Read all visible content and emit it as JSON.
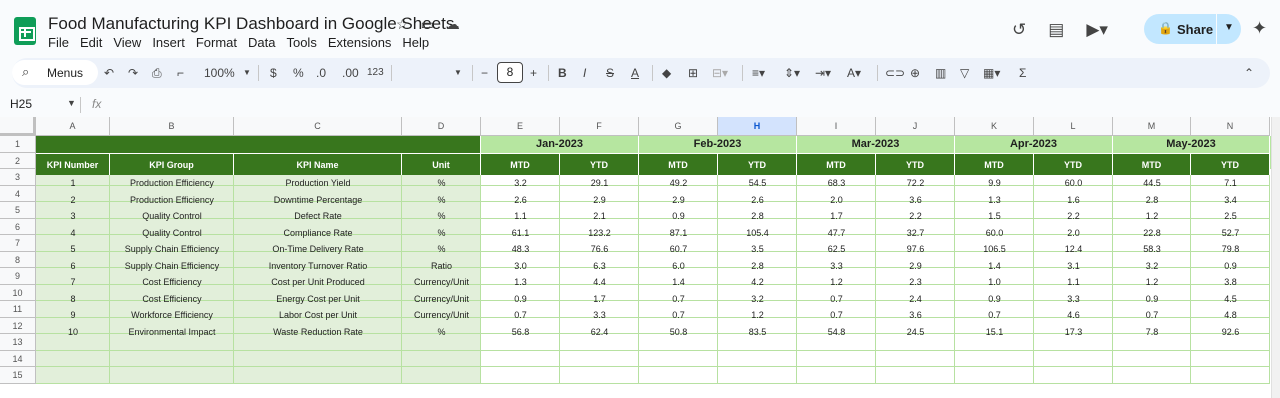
{
  "app": {
    "title": "Food Manufacturing KPI Dashboard in Google Sheets",
    "menu": [
      "File",
      "Edit",
      "View",
      "Insert",
      "Format",
      "Data",
      "Tools",
      "Extensions",
      "Help"
    ],
    "share_label": "Share"
  },
  "toolbar": {
    "menus_label": "Menus",
    "zoom": "100%",
    "currency": "$",
    "percent": "%",
    "dec_decrease": ".0",
    "dec_increase": ".00",
    "number_format": "123",
    "font_size": "8"
  },
  "formula_bar": {
    "cell_ref": "H25",
    "fx": "fx"
  },
  "colors": {
    "header_dark": "#38761d",
    "header_light": "#b6e6a0",
    "info_bg": "#e2efda",
    "grid_line": "#b7e1a1",
    "selected_col": "#d3e3fd"
  },
  "columns": [
    "A",
    "B",
    "C",
    "D",
    "E",
    "F",
    "G",
    "H",
    "I",
    "J",
    "K",
    "L",
    "M",
    "N"
  ],
  "selected_column": "H",
  "rows": [
    "1",
    "2",
    "3",
    "4",
    "5",
    "6",
    "7",
    "8",
    "9",
    "10",
    "11",
    "12",
    "13",
    "14",
    "15"
  ],
  "months": [
    "Jan-2023",
    "Feb-2023",
    "Mar-2023",
    "Apr-2023",
    "May-2023"
  ],
  "headers": [
    "KPI Number",
    "KPI Group",
    "KPI Name",
    "Unit"
  ],
  "subheaders": [
    "MTD",
    "YTD"
  ],
  "kpis": [
    {
      "num": "1",
      "group": "Production Efficiency",
      "name": "Production Yield",
      "unit": "%",
      "vals": [
        "3.2",
        "29.1",
        "49.2",
        "54.5",
        "68.3",
        "72.2",
        "9.9",
        "60.0",
        "44.5",
        "7.1"
      ]
    },
    {
      "num": "2",
      "group": "Production Efficiency",
      "name": "Downtime Percentage",
      "unit": "%",
      "vals": [
        "2.6",
        "2.9",
        "2.9",
        "2.6",
        "2.0",
        "3.6",
        "1.3",
        "1.6",
        "2.8",
        "3.4"
      ]
    },
    {
      "num": "3",
      "group": "Quality Control",
      "name": "Defect Rate",
      "unit": "%",
      "vals": [
        "1.1",
        "2.1",
        "0.9",
        "2.8",
        "1.7",
        "2.2",
        "1.5",
        "2.2",
        "1.2",
        "2.5"
      ]
    },
    {
      "num": "4",
      "group": "Quality Control",
      "name": "Compliance Rate",
      "unit": "%",
      "vals": [
        "61.1",
        "123.2",
        "87.1",
        "105.4",
        "47.7",
        "32.7",
        "60.0",
        "2.0",
        "22.8",
        "52.7"
      ]
    },
    {
      "num": "5",
      "group": "Supply Chain Efficiency",
      "name": "On-Time Delivery Rate",
      "unit": "%",
      "vals": [
        "48.3",
        "76.6",
        "60.7",
        "3.5",
        "62.5",
        "97.6",
        "106.5",
        "12.4",
        "58.3",
        "79.8"
      ]
    },
    {
      "num": "6",
      "group": "Supply Chain Efficiency",
      "name": "Inventory Turnover Ratio",
      "unit": "Ratio",
      "vals": [
        "3.0",
        "6.3",
        "6.0",
        "2.8",
        "3.3",
        "2.9",
        "1.4",
        "3.1",
        "3.2",
        "0.9"
      ]
    },
    {
      "num": "7",
      "group": "Cost Efficiency",
      "name": "Cost per Unit Produced",
      "unit": "Currency/Unit",
      "vals": [
        "1.3",
        "4.4",
        "1.4",
        "4.2",
        "1.2",
        "2.3",
        "1.0",
        "1.1",
        "1.2",
        "3.8"
      ]
    },
    {
      "num": "8",
      "group": "Cost Efficiency",
      "name": "Energy Cost per Unit",
      "unit": "Currency/Unit",
      "vals": [
        "0.9",
        "1.7",
        "0.7",
        "3.2",
        "0.7",
        "2.4",
        "0.9",
        "3.3",
        "0.9",
        "4.5"
      ]
    },
    {
      "num": "9",
      "group": "Workforce Efficiency",
      "name": "Labor Cost per Unit",
      "unit": "Currency/Unit",
      "vals": [
        "0.7",
        "3.3",
        "0.7",
        "1.2",
        "0.7",
        "3.6",
        "0.7",
        "4.6",
        "0.7",
        "4.8"
      ]
    },
    {
      "num": "10",
      "group": "Environmental Impact",
      "name": "Waste Reduction Rate",
      "unit": "%",
      "vals": [
        "56.8",
        "62.4",
        "50.8",
        "83.5",
        "54.8",
        "24.5",
        "15.1",
        "17.3",
        "7.8",
        "92.6"
      ]
    }
  ]
}
